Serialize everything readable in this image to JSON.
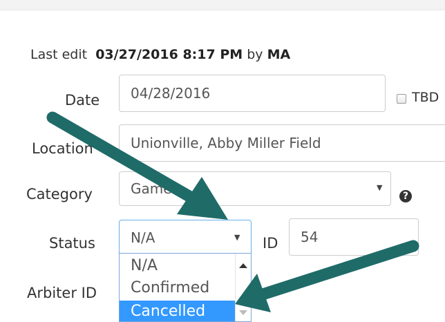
{
  "last_edit": {
    "label": "Last edit",
    "datetime": "03/27/2016 8:17 PM",
    "by_word": "by",
    "user": "MA"
  },
  "date": {
    "label": "Date",
    "value": "04/28/2016",
    "tbd_label": "TBD"
  },
  "location": {
    "label": "Location",
    "value": "Unionville, Abby Miller Field"
  },
  "category": {
    "label": "Category",
    "value": "Game"
  },
  "status": {
    "label": "Status",
    "value": "N/A",
    "options": [
      "N/A",
      "Confirmed",
      "Cancelled"
    ],
    "highlighted": "Cancelled"
  },
  "id": {
    "label": "ID",
    "value": "54"
  },
  "arbiter": {
    "label": "Arbiter ID"
  },
  "help_glyph": "?",
  "colors": {
    "arrow": "#1f6b68",
    "highlight": "#3399ff"
  }
}
